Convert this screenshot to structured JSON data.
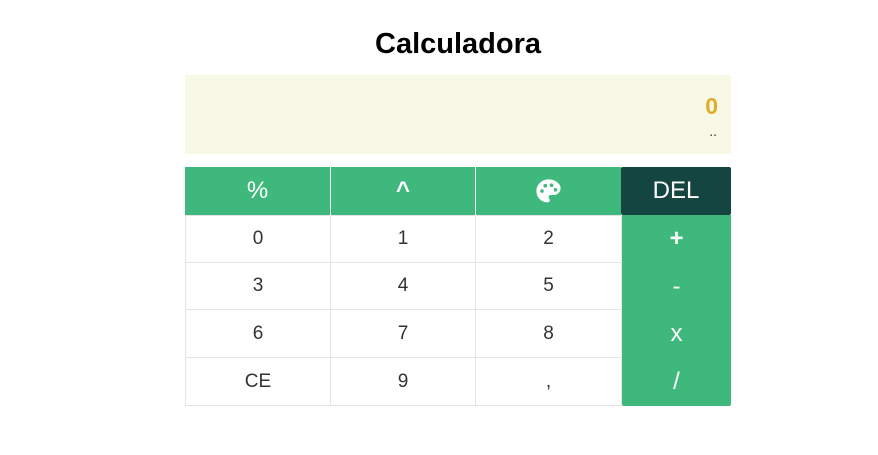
{
  "title": "Calculadora",
  "display": {
    "value": "0",
    "sub": ".."
  },
  "keys": {
    "percent": "%",
    "power": "^",
    "palette_icon": "palette-icon",
    "del": "DEL",
    "k0": "0",
    "k1": "1",
    "k2": "2",
    "plus": "+",
    "k3": "3",
    "k4": "4",
    "k5": "5",
    "minus": "-",
    "k6": "6",
    "k7": "7",
    "k8": "8",
    "times": "x",
    "ce": "CE",
    "k9": "9",
    "comma": ",",
    "divide": "/"
  },
  "colors": {
    "accent": "#3fb87d",
    "del_bg": "#144540",
    "display_bg": "#f7f9e6",
    "display_value": "#e0ad2a"
  }
}
